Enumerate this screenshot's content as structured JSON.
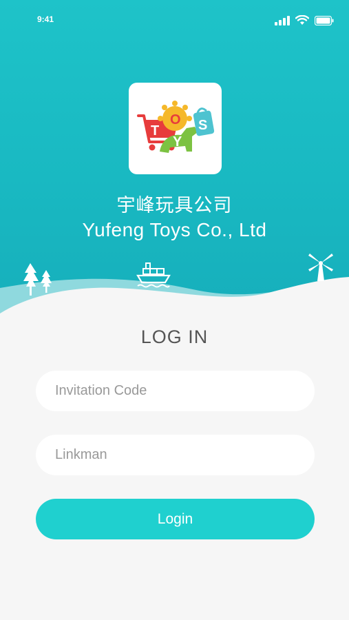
{
  "status_bar": {
    "time": "9:41",
    "icons": [
      "signal-icon",
      "wifi-icon",
      "battery-icon"
    ]
  },
  "brand": {
    "logo_icon": "toys-logo-icon",
    "logo_letters": [
      "T",
      "O",
      "Y",
      "S"
    ],
    "name_cn": "宇峰玩具公司",
    "name_en": "Yufeng Toys Co., Ltd"
  },
  "decorations": [
    "tree-icon",
    "ship-icon",
    "windmill-icon"
  ],
  "login": {
    "title": "LOG IN",
    "invitation_placeholder": "Invitation Code",
    "invitation_value": "",
    "linkman_placeholder": "Linkman",
    "linkman_value": "",
    "button_label": "Login"
  },
  "colors": {
    "primary": "#1ec3c9",
    "button": "#1fd0cf",
    "background": "#f6f6f6",
    "title_text": "#555555",
    "placeholder_text": "#999999"
  }
}
